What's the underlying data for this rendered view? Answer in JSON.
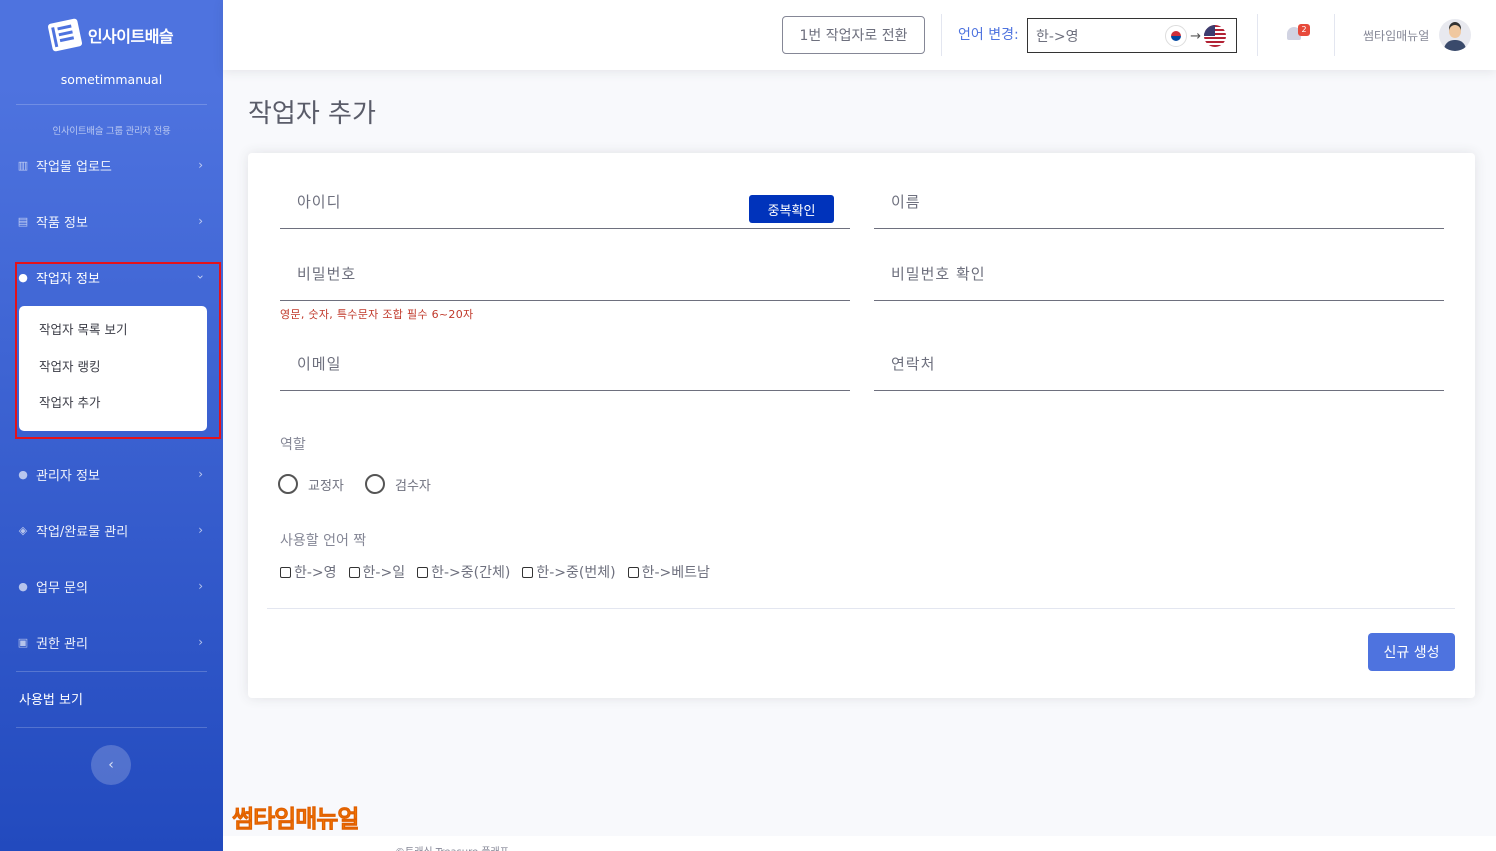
{
  "sidebar": {
    "brand": "인사이트배슬",
    "subtitle": "sometimmanual",
    "heading": "인사이트배슬 그룹 관리자 전용",
    "items": [
      {
        "label": "작업물 업로드"
      },
      {
        "label": "작품 정보"
      },
      {
        "label": "작업자 정보"
      },
      {
        "label": "관리자 정보"
      },
      {
        "label": "작업/완료물 관리"
      },
      {
        "label": "업무 문의"
      },
      {
        "label": "권한 관리"
      }
    ],
    "submenu": [
      "작업자 목록 보기",
      "작업자 랭킹",
      "작업자 추가"
    ],
    "usage": "사용법 보기"
  },
  "topbar": {
    "switch_label": "1번 작업자로 전환",
    "lang_label": "언어 변경:",
    "lang_value": "한->영",
    "badge_count": "2",
    "user_name": "썸타임매뉴얼"
  },
  "page": {
    "title": "작업자 추가"
  },
  "form": {
    "id_label": "아이디",
    "dup_button": "중복확인",
    "name_label": "이름",
    "password_label": "비밀번호",
    "password_confirm_label": "비밀번호 확인",
    "password_hint": "영문, 숫자, 특수문자 조합 필수 6~20자",
    "email_label": "이메일",
    "phone_label": "연락처",
    "role_label": "역할",
    "roles": [
      "교정자",
      "검수자"
    ],
    "lang_pairs_label": "사용할 언어 짝",
    "lang_pairs": [
      "한->영",
      "한->일",
      "한->중(간체)",
      "한->중(번체)",
      "한->베트남"
    ],
    "create_button": "신규 생성"
  },
  "watermark": "썸타임매뉴얼",
  "footer": {
    "text": "©트래식 Treasure 플래프"
  },
  "colors": {
    "primary": "#4e73df",
    "dup_button": "#0033bb",
    "highlight": "#e3121b",
    "hint": "#c0392b",
    "watermark": "#ff8a00"
  }
}
